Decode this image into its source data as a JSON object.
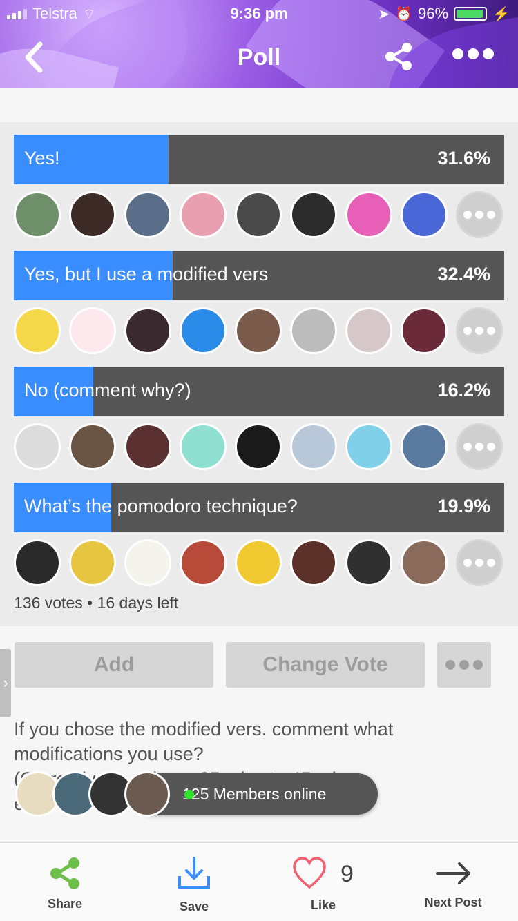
{
  "status_bar": {
    "carrier": "Telstra",
    "time": "9:36 pm",
    "battery": "96%",
    "battery_level": 0.96
  },
  "header": {
    "title": "Poll",
    "back_icon": "chevron-left-icon",
    "share_icon": "share-icon",
    "more_icon": "more-dots-icon"
  },
  "poll": {
    "options": [
      {
        "label": "Yes!",
        "percent_text": "31.6%",
        "percent": 31.6
      },
      {
        "label": "Yes, but I use a modified vers",
        "percent_text": "32.4%",
        "percent": 32.4
      },
      {
        "label": "No (comment why?)",
        "percent_text": "16.2%",
        "percent": 16.2
      },
      {
        "label": "What’s the pomodoro technique?",
        "percent_text": "19.9%",
        "percent": 19.9
      }
    ],
    "voter_colors": [
      [
        "#6e8f6a",
        "#3b2a25",
        "#5a6e8a",
        "#e8a0b0",
        "#4a4a4a",
        "#2b2b2b",
        "#e85fb8",
        "#4a67d8"
      ],
      [
        "#f5d84a",
        "#fde8ee",
        "#3a2a30",
        "#2b8be8",
        "#7a5a4a",
        "#bcbcbc",
        "#d6c8c8",
        "#6a2a3a"
      ],
      [
        "#dcdcdc",
        "#6a5545",
        "#5a3030",
        "#8fe0d0",
        "#1a1a1a",
        "#b8c8d8",
        "#7fd0e8",
        "#5a7aa0"
      ],
      [
        "#2a2a2a",
        "#e6c640",
        "#f4f4ec",
        "#b84a3a",
        "#f0c830",
        "#5a3028",
        "#303030",
        "#8a6a5a"
      ]
    ],
    "summary": "136 votes • 16 days left"
  },
  "actions": {
    "add_label": "Add",
    "change_vote_label": "Change Vote",
    "side_tab_glyph": "›"
  },
  "description": {
    "line1": "If you chose the modified vers. comment what",
    "line2": "modifications you use?",
    "line3": "(Currently the... the ... 25 mins to 45 mins",
    "line4": "e..."
  },
  "online": {
    "text": "125 Members online",
    "avatar_colors": [
      "#e8dcc0",
      "#4a6a7a",
      "#333333",
      "#6a5a50"
    ]
  },
  "bottom_nav": {
    "share_label": "Share",
    "save_label": "Save",
    "like_label": "Like",
    "like_count": "9",
    "next_label": "Next Post",
    "share_color": "#6cc04a",
    "save_color": "#3a8dff",
    "like_color": "#f06070"
  }
}
